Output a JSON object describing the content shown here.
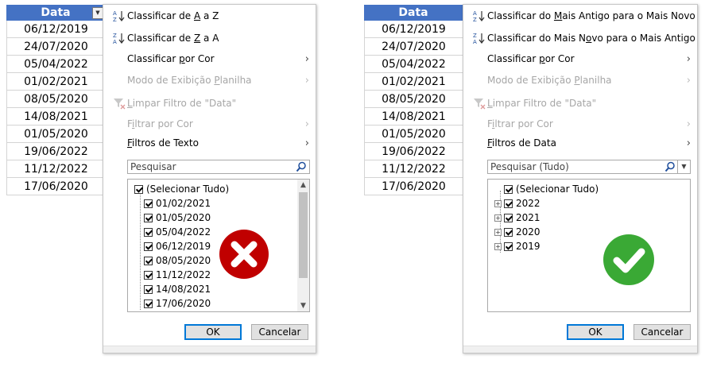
{
  "left": {
    "column_header": "Data",
    "cells": [
      "06/12/2019",
      "24/07/2020",
      "05/04/2022",
      "01/02/2021",
      "08/05/2020",
      "14/08/2021",
      "01/05/2020",
      "19/06/2022",
      "11/12/2022",
      "17/06/2020"
    ],
    "menu": {
      "sort_asc": {
        "pre": "Classificar de ",
        "u": "A",
        "post": " a Z"
      },
      "sort_desc": {
        "pre": "Classificar de ",
        "u": "Z",
        "post": " a A"
      },
      "sort_color": {
        "pre": "Classificar ",
        "u": "p",
        "post": "or Cor"
      },
      "sheet_view": {
        "pre": "Modo de Exibição ",
        "u": "P",
        "post": "lanilha"
      },
      "clear_filter": {
        "pre": "",
        "u": "L",
        "post": "impar Filtro de \"Data\""
      },
      "filter_color": {
        "pre": "F",
        "u": "i",
        "post": "ltrar por Cor"
      },
      "text_filters": {
        "pre": "",
        "u": "F",
        "post": "iltros de Texto"
      },
      "search_placeholder": "Pesquisar",
      "items": [
        "(Selecionar Tudo)",
        "01/02/2021",
        "01/05/2020",
        "05/04/2022",
        "06/12/2019",
        "08/05/2020",
        "11/12/2022",
        "14/08/2021",
        "17/06/2020"
      ],
      "ok": "OK",
      "cancel": "Cancelar"
    },
    "badge_icon": "x-mark-icon",
    "badge_color": "#c00000"
  },
  "right": {
    "column_header": "Data",
    "cells": [
      "06/12/2019",
      "24/07/2020",
      "05/04/2022",
      "01/02/2021",
      "08/05/2020",
      "14/08/2021",
      "01/05/2020",
      "19/06/2022",
      "11/12/2022",
      "17/06/2020"
    ],
    "menu": {
      "sort_asc": {
        "pre": "Classificar do ",
        "u": "M",
        "post": "ais Antigo para o Mais Novo"
      },
      "sort_desc": {
        "pre": "Classificar do Mais N",
        "u": "o",
        "post": "vo para o Mais Antigo"
      },
      "sort_color": {
        "pre": "Classificar ",
        "u": "p",
        "post": "or Cor"
      },
      "sheet_view": {
        "pre": "Modo de Exibição ",
        "u": "P",
        "post": "lanilha"
      },
      "clear_filter": {
        "pre": "",
        "u": "L",
        "post": "impar Filtro de \"Data\""
      },
      "filter_color": {
        "pre": "F",
        "u": "i",
        "post": "ltrar por Cor"
      },
      "date_filters": {
        "pre": "",
        "u": "F",
        "post": "iltros de Data"
      },
      "search_placeholder": "Pesquisar (Tudo)",
      "select_all": "(Selecionar Tudo)",
      "years": [
        "2022",
        "2021",
        "2020",
        "2019"
      ],
      "ok": "OK",
      "cancel": "Cancelar"
    },
    "badge_icon": "check-mark-icon",
    "badge_color": "#3aa935"
  }
}
